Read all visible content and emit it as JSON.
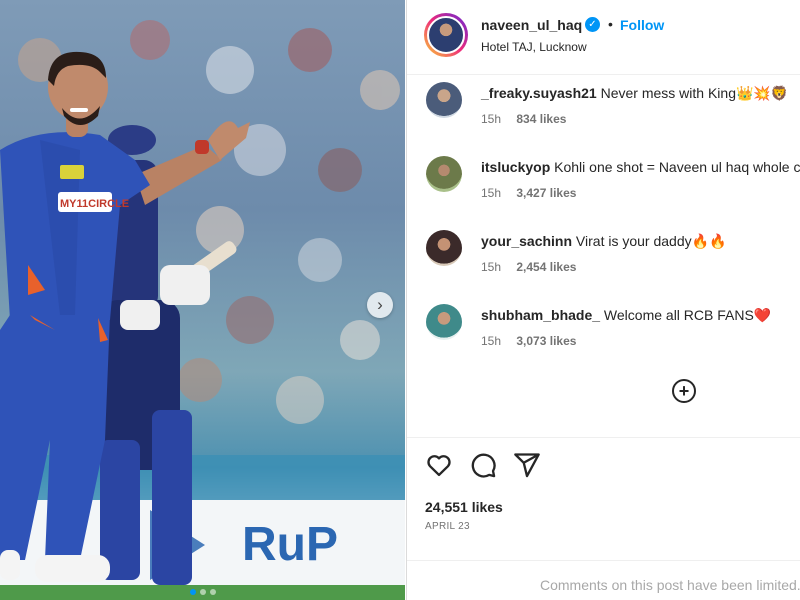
{
  "header": {
    "username": "naveen_ul_haq",
    "verified_mark": "✓",
    "separator": "•",
    "follow_label": "Follow",
    "location": "Hotel TAJ, Lucknow"
  },
  "photo": {
    "jersey_brand": "MY11CIRCLE",
    "banner_text": "RuP",
    "carousel_next_glyph": "›",
    "slide_count": 3,
    "active_slide": 1
  },
  "comments": [
    {
      "user": "_freaky.suyash21",
      "text": "Never mess with King👑💥🦁",
      "time": "15h",
      "likes": "834 likes"
    },
    {
      "user": "itsluckyop",
      "text": "Kohli one shot = Naveen ul haq whole career",
      "time": "15h",
      "likes": "3,427 likes"
    },
    {
      "user": "your_sachinn",
      "text": "Virat is your daddy🔥🔥",
      "time": "15h",
      "likes": "2,454 likes"
    },
    {
      "user": "shubham_bhade_",
      "text": "Welcome all RCB FANS❤️",
      "time": "15h",
      "likes": "3,073 likes"
    }
  ],
  "load_more_glyph": "+",
  "likes_total": "24,551 likes",
  "post_date": "APRIL 23",
  "comments_disabled": "Comments on this post have been limited.",
  "colors": {
    "accent": "#0095f6",
    "jersey": "#2f53b8",
    "jersey_trim": "#e8612c",
    "text": "#262626",
    "muted": "#737373"
  }
}
